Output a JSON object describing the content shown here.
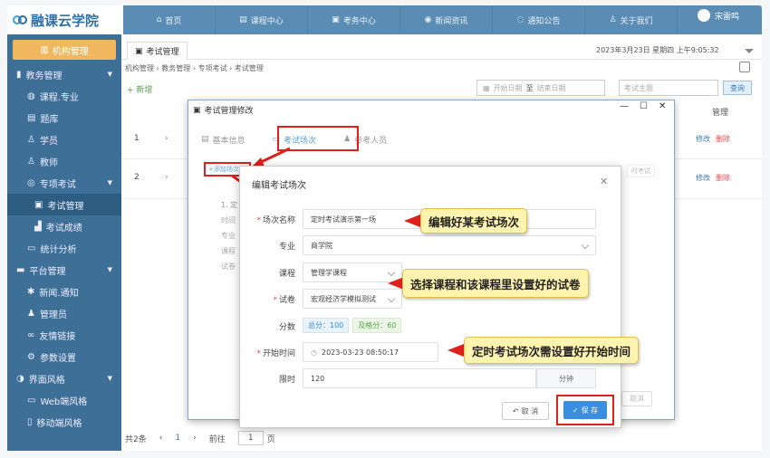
{
  "app": {
    "logo": "融课云学院"
  },
  "nav": [
    {
      "label": "首页",
      "icon": "home-icon"
    },
    {
      "label": "课程中心",
      "icon": "book-icon"
    },
    {
      "label": "考务中心",
      "icon": "exam-icon"
    },
    {
      "label": "新闻资讯",
      "icon": "news-icon"
    },
    {
      "label": "通知公告",
      "icon": "bell-icon"
    },
    {
      "label": "关于我们",
      "icon": "info-icon"
    }
  ],
  "user": {
    "name": "宋雷鸣"
  },
  "sidebar": {
    "org": "机构管理",
    "items": [
      {
        "label": "教务管理"
      },
      {
        "label": "课程.专业"
      },
      {
        "label": "题库"
      },
      {
        "label": "学员"
      },
      {
        "label": "教师"
      },
      {
        "label": "专项考试"
      },
      {
        "label": "考试管理"
      },
      {
        "label": "考试成绩"
      },
      {
        "label": "统计分析"
      },
      {
        "label": "平台管理"
      },
      {
        "label": "新闻.通知"
      },
      {
        "label": "管理员"
      },
      {
        "label": "友情链接"
      },
      {
        "label": "参数设置"
      },
      {
        "label": "界面风格"
      },
      {
        "label": "Web端风格"
      },
      {
        "label": "移动端风格"
      }
    ]
  },
  "tab": {
    "label": "考试管理"
  },
  "datetime": "2023年3月23日 星期四 上午9:05:32",
  "breadcrumb": "机构管理 › 教务管理 › 专项考试 › 考试管理",
  "toolbar": {
    "add": "+ 新增",
    "start_date": "开始日期",
    "end_date": "结束日期",
    "sep": "至",
    "keyword_placeholder": "考试主题",
    "query": "查询"
  },
  "table": {
    "ops_header": "管理",
    "rows": [
      {
        "num": "1",
        "edit": "修改",
        "delete": "删除"
      },
      {
        "num": "2",
        "edit": "修改",
        "delete": "删除"
      }
    ]
  },
  "pager": {
    "total": "共2条",
    "page": "1",
    "goto": "前往",
    "goto_value": "1",
    "page_unit": "页"
  },
  "dialog1": {
    "title": "考试管理修改",
    "tabs": [
      "基本信息",
      "考试场次",
      "参考人员"
    ],
    "add_btn": "+添加场次",
    "bg_text": [
      "1. 定",
      "时间",
      "专业",
      "课程",
      "试卷"
    ],
    "right_tag": "时考试",
    "cancel": "取消"
  },
  "dialog2": {
    "title": "编辑考试场次",
    "fields": {
      "name_label": "场次名称",
      "name_value": "定时考试演示第一场",
      "major_label": "专业",
      "major_value": "商学院",
      "course_label": "课程",
      "course_value": "管理学课程",
      "paper_label": "试卷",
      "paper_value": "宏观经济学模拟测试",
      "score_label": "分数",
      "total": "总分：100",
      "pass": "及格分：60",
      "start_label": "开始时间",
      "start_value": "2023-03-23 08:50:17",
      "limit_label": "限时",
      "limit_value": "120",
      "limit_unit": "分钟"
    },
    "cancel": "取 消",
    "save": "保 存"
  },
  "callouts": {
    "c1": "编辑好某考试场次",
    "c2": "选择课程和该课程里设置好的试卷",
    "c3": "定时考试场次需设置好开始时间"
  }
}
